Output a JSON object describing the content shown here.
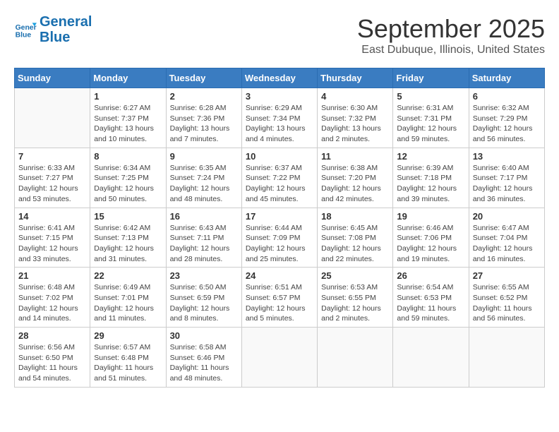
{
  "header": {
    "logo_line1": "General",
    "logo_line2": "Blue",
    "month": "September 2025",
    "location": "East Dubuque, Illinois, United States"
  },
  "weekdays": [
    "Sunday",
    "Monday",
    "Tuesday",
    "Wednesday",
    "Thursday",
    "Friday",
    "Saturday"
  ],
  "weeks": [
    [
      {
        "day": "",
        "sunrise": "",
        "sunset": "",
        "daylight": ""
      },
      {
        "day": "1",
        "sunrise": "Sunrise: 6:27 AM",
        "sunset": "Sunset: 7:37 PM",
        "daylight": "Daylight: 13 hours and 10 minutes."
      },
      {
        "day": "2",
        "sunrise": "Sunrise: 6:28 AM",
        "sunset": "Sunset: 7:36 PM",
        "daylight": "Daylight: 13 hours and 7 minutes."
      },
      {
        "day": "3",
        "sunrise": "Sunrise: 6:29 AM",
        "sunset": "Sunset: 7:34 PM",
        "daylight": "Daylight: 13 hours and 4 minutes."
      },
      {
        "day": "4",
        "sunrise": "Sunrise: 6:30 AM",
        "sunset": "Sunset: 7:32 PM",
        "daylight": "Daylight: 13 hours and 2 minutes."
      },
      {
        "day": "5",
        "sunrise": "Sunrise: 6:31 AM",
        "sunset": "Sunset: 7:31 PM",
        "daylight": "Daylight: 12 hours and 59 minutes."
      },
      {
        "day": "6",
        "sunrise": "Sunrise: 6:32 AM",
        "sunset": "Sunset: 7:29 PM",
        "daylight": "Daylight: 12 hours and 56 minutes."
      }
    ],
    [
      {
        "day": "7",
        "sunrise": "Sunrise: 6:33 AM",
        "sunset": "Sunset: 7:27 PM",
        "daylight": "Daylight: 12 hours and 53 minutes."
      },
      {
        "day": "8",
        "sunrise": "Sunrise: 6:34 AM",
        "sunset": "Sunset: 7:25 PM",
        "daylight": "Daylight: 12 hours and 50 minutes."
      },
      {
        "day": "9",
        "sunrise": "Sunrise: 6:35 AM",
        "sunset": "Sunset: 7:24 PM",
        "daylight": "Daylight: 12 hours and 48 minutes."
      },
      {
        "day": "10",
        "sunrise": "Sunrise: 6:37 AM",
        "sunset": "Sunset: 7:22 PM",
        "daylight": "Daylight: 12 hours and 45 minutes."
      },
      {
        "day": "11",
        "sunrise": "Sunrise: 6:38 AM",
        "sunset": "Sunset: 7:20 PM",
        "daylight": "Daylight: 12 hours and 42 minutes."
      },
      {
        "day": "12",
        "sunrise": "Sunrise: 6:39 AM",
        "sunset": "Sunset: 7:18 PM",
        "daylight": "Daylight: 12 hours and 39 minutes."
      },
      {
        "day": "13",
        "sunrise": "Sunrise: 6:40 AM",
        "sunset": "Sunset: 7:17 PM",
        "daylight": "Daylight: 12 hours and 36 minutes."
      }
    ],
    [
      {
        "day": "14",
        "sunrise": "Sunrise: 6:41 AM",
        "sunset": "Sunset: 7:15 PM",
        "daylight": "Daylight: 12 hours and 33 minutes."
      },
      {
        "day": "15",
        "sunrise": "Sunrise: 6:42 AM",
        "sunset": "Sunset: 7:13 PM",
        "daylight": "Daylight: 12 hours and 31 minutes."
      },
      {
        "day": "16",
        "sunrise": "Sunrise: 6:43 AM",
        "sunset": "Sunset: 7:11 PM",
        "daylight": "Daylight: 12 hours and 28 minutes."
      },
      {
        "day": "17",
        "sunrise": "Sunrise: 6:44 AM",
        "sunset": "Sunset: 7:09 PM",
        "daylight": "Daylight: 12 hours and 25 minutes."
      },
      {
        "day": "18",
        "sunrise": "Sunrise: 6:45 AM",
        "sunset": "Sunset: 7:08 PM",
        "daylight": "Daylight: 12 hours and 22 minutes."
      },
      {
        "day": "19",
        "sunrise": "Sunrise: 6:46 AM",
        "sunset": "Sunset: 7:06 PM",
        "daylight": "Daylight: 12 hours and 19 minutes."
      },
      {
        "day": "20",
        "sunrise": "Sunrise: 6:47 AM",
        "sunset": "Sunset: 7:04 PM",
        "daylight": "Daylight: 12 hours and 16 minutes."
      }
    ],
    [
      {
        "day": "21",
        "sunrise": "Sunrise: 6:48 AM",
        "sunset": "Sunset: 7:02 PM",
        "daylight": "Daylight: 12 hours and 14 minutes."
      },
      {
        "day": "22",
        "sunrise": "Sunrise: 6:49 AM",
        "sunset": "Sunset: 7:01 PM",
        "daylight": "Daylight: 12 hours and 11 minutes."
      },
      {
        "day": "23",
        "sunrise": "Sunrise: 6:50 AM",
        "sunset": "Sunset: 6:59 PM",
        "daylight": "Daylight: 12 hours and 8 minutes."
      },
      {
        "day": "24",
        "sunrise": "Sunrise: 6:51 AM",
        "sunset": "Sunset: 6:57 PM",
        "daylight": "Daylight: 12 hours and 5 minutes."
      },
      {
        "day": "25",
        "sunrise": "Sunrise: 6:53 AM",
        "sunset": "Sunset: 6:55 PM",
        "daylight": "Daylight: 12 hours and 2 minutes."
      },
      {
        "day": "26",
        "sunrise": "Sunrise: 6:54 AM",
        "sunset": "Sunset: 6:53 PM",
        "daylight": "Daylight: 11 hours and 59 minutes."
      },
      {
        "day": "27",
        "sunrise": "Sunrise: 6:55 AM",
        "sunset": "Sunset: 6:52 PM",
        "daylight": "Daylight: 11 hours and 56 minutes."
      }
    ],
    [
      {
        "day": "28",
        "sunrise": "Sunrise: 6:56 AM",
        "sunset": "Sunset: 6:50 PM",
        "daylight": "Daylight: 11 hours and 54 minutes."
      },
      {
        "day": "29",
        "sunrise": "Sunrise: 6:57 AM",
        "sunset": "Sunset: 6:48 PM",
        "daylight": "Daylight: 11 hours and 51 minutes."
      },
      {
        "day": "30",
        "sunrise": "Sunrise: 6:58 AM",
        "sunset": "Sunset: 6:46 PM",
        "daylight": "Daylight: 11 hours and 48 minutes."
      },
      {
        "day": "",
        "sunrise": "",
        "sunset": "",
        "daylight": ""
      },
      {
        "day": "",
        "sunrise": "",
        "sunset": "",
        "daylight": ""
      },
      {
        "day": "",
        "sunrise": "",
        "sunset": "",
        "daylight": ""
      },
      {
        "day": "",
        "sunrise": "",
        "sunset": "",
        "daylight": ""
      }
    ]
  ]
}
